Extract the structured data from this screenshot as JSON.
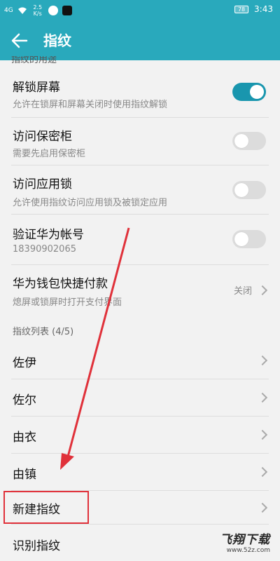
{
  "status_bar": {
    "signal": "4G",
    "speed": "2.5 K/s",
    "battery": "78",
    "time": "3:43"
  },
  "app_bar": {
    "title": "指纹"
  },
  "partial_text": "指纹的用途",
  "settings": [
    {
      "title": "解锁屏幕",
      "subtitle": "允许在锁屏和屏幕关闭时使用指纹解锁",
      "state": "on"
    },
    {
      "title": "访问保密柜",
      "subtitle": "需要先启用保密柜",
      "state": "off"
    },
    {
      "title": "访问应用锁",
      "subtitle": "允许使用指纹访问应用锁及被锁定应用",
      "state": "off"
    },
    {
      "title": "验证华为帐号",
      "subtitle": "18390902065",
      "state": "off"
    },
    {
      "title": "华为钱包快捷付款",
      "subtitle": "熄屏或锁屏时打开支付界面",
      "value": "关闭"
    }
  ],
  "fingerprint_section": {
    "header": "指纹列表 (4/5)",
    "items": [
      "佐伊",
      "佐尔",
      "由衣",
      "由镇",
      "新建指纹",
      "识别指纹"
    ]
  },
  "watermark": {
    "main": "飞翔下载",
    "sub": "www.52z.com"
  },
  "colors": {
    "accent": "#29a9bc",
    "toggle_on": "#1996ae",
    "highlight": "#e0313a"
  }
}
